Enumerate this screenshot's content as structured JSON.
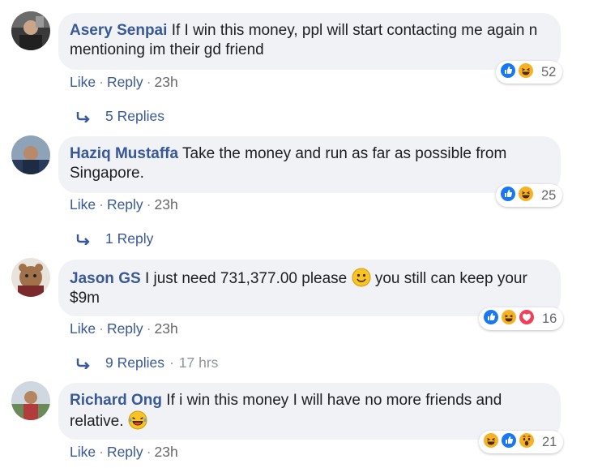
{
  "comments": [
    {
      "author": "Asery Senpai",
      "text": "If I win this money, ppl will start contacting me again n mentioning im their gd friend",
      "like": "Like",
      "reply": "Reply",
      "time": "23h",
      "reaction_count": "52",
      "reactions": [
        "like-icon",
        "haha-icon"
      ],
      "replies": "5 Replies",
      "reply_time": ""
    },
    {
      "author": "Haziq Mustaffa",
      "text": "Take the money and run as far as possible from Singapore.",
      "like": "Like",
      "reply": "Reply",
      "time": "23h",
      "reaction_count": "25",
      "reactions": [
        "like-icon",
        "haha-icon"
      ],
      "replies": "1 Reply",
      "reply_time": ""
    },
    {
      "author": "Jason GS",
      "text_before": "I just need 731,377.00 please",
      "text_after": "you still can keep your $9m",
      "like": "Like",
      "reply": "Reply",
      "time": "23h",
      "reaction_count": "16",
      "reactions": [
        "like-icon",
        "haha-icon",
        "love-icon"
      ],
      "replies": "9 Replies",
      "reply_time": "17 hrs"
    },
    {
      "author": "Richard Ong",
      "text": "If i win this money I will have no more friends and relative.",
      "like": "Like",
      "reply": "Reply",
      "time": "23h",
      "reaction_count": "21",
      "reactions": [
        "haha-icon",
        "like-icon",
        "wow-icon"
      ]
    }
  ],
  "separator": "·",
  "colors": {
    "link": "#385898",
    "bubble": "#f0f2f5",
    "meta": "#65676b",
    "like": "#1877f2",
    "haha": "#f7b125",
    "love": "#f33e58"
  }
}
